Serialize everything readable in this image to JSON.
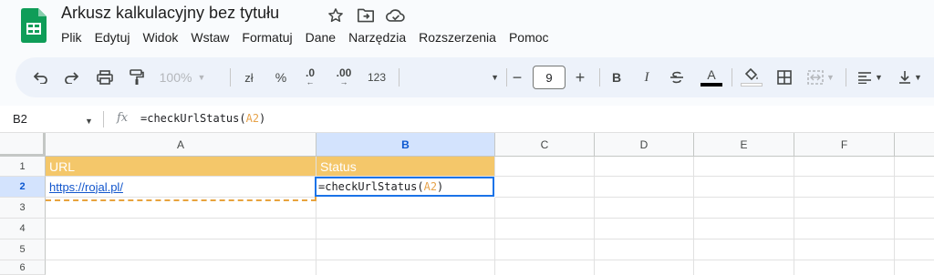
{
  "app": {
    "doc_title": "Arkusz kalkulacyjny bez tytułu",
    "logo": "google-sheets-logo",
    "title_icons": [
      "star-icon",
      "move-to-folder-icon",
      "cloud-status-icon"
    ]
  },
  "menu": [
    "Plik",
    "Edytuj",
    "Widok",
    "Wstaw",
    "Formatuj",
    "Dane",
    "Narzędzia",
    "Rozszerzenia",
    "Pomoc"
  ],
  "toolbar": {
    "zoom": "100%",
    "currency": "zł",
    "percent": "%",
    "decimal_decrease": ".0",
    "decimal_increase": ".00",
    "number_format": "123",
    "font_size": "9",
    "bold": "B",
    "italic": "I",
    "text_color": "A"
  },
  "formula_bar": {
    "cell_ref": "B2",
    "fx": "fx",
    "formula_pre": "=checkUrlStatus(",
    "formula_ref": "A2",
    "formula_post": ")"
  },
  "columns": [
    "A",
    "B",
    "C",
    "D",
    "E",
    "F"
  ],
  "rows": [
    "1",
    "2",
    "3",
    "4",
    "5",
    "6"
  ],
  "cells": {
    "A1": "URL",
    "B1": "Status",
    "A2": "https://rojal.pl/",
    "B2_pre": "=checkUrlStatus(",
    "B2_ref": "A2",
    "B2_post": ")"
  },
  "colors": {
    "header_fill": "#f4c76a",
    "selection_blue": "#1a73e8",
    "ref_orange": "#e7a34b",
    "link_blue": "#1155cc"
  }
}
